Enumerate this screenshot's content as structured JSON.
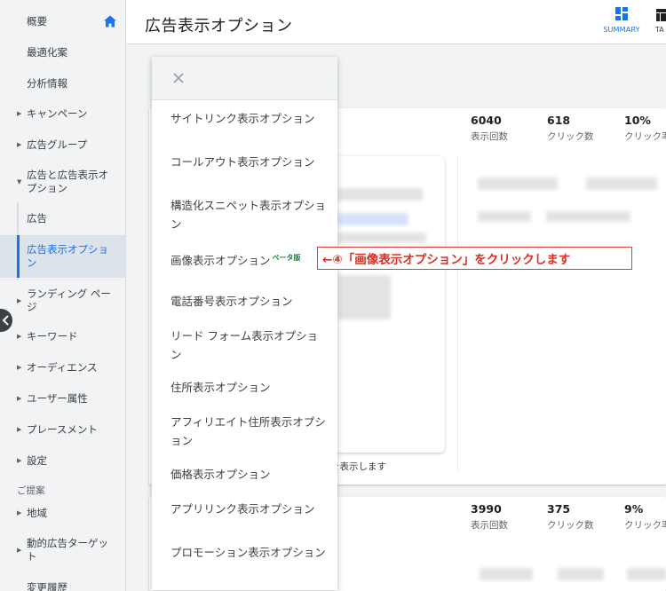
{
  "sidebar": {
    "items": [
      {
        "label": "概要",
        "level": "top"
      },
      {
        "label": "最適化案",
        "level": "top"
      },
      {
        "label": "分析情報",
        "level": "top"
      },
      {
        "label": "キャンペーン",
        "level": "group"
      },
      {
        "label": "広告グループ",
        "level": "group"
      },
      {
        "label": "広告と広告表示オプション",
        "level": "group-open"
      },
      {
        "label": "広告",
        "level": "sub"
      },
      {
        "label": "広告表示オプション",
        "level": "sub-selected"
      },
      {
        "label": "ランディング ページ",
        "level": "group"
      },
      {
        "label": "キーワード",
        "level": "group"
      },
      {
        "label": "オーディエンス",
        "level": "group"
      },
      {
        "label": "ユーザー属性",
        "level": "group"
      },
      {
        "label": "プレースメント",
        "level": "group"
      },
      {
        "label": "設定",
        "level": "group"
      },
      {
        "label": "地域",
        "level": "group"
      },
      {
        "label": "動的広告ターゲット",
        "level": "group"
      },
      {
        "label": "変更履歴",
        "level": "top"
      }
    ],
    "section_title": "ご提案",
    "home_icon": "home-icon",
    "accent_color": "#1a73e8"
  },
  "header": {
    "title": "広告表示オプション",
    "summary_label": "SUMMARY",
    "table_label": "TA"
  },
  "cards": [
    {
      "stats": [
        {
          "value": "6040",
          "caption": "表示回数"
        },
        {
          "value": "618",
          "caption": "クリック数"
        },
        {
          "value": "10%",
          "caption": "クリック率"
        }
      ],
      "footnote": "を表示します"
    },
    {
      "stats": [
        {
          "value": "3990",
          "caption": "表示回数"
        },
        {
          "value": "375",
          "caption": "クリック数"
        },
        {
          "value": "9%",
          "caption": "クリック率"
        }
      ]
    }
  ],
  "menu": {
    "close_icon": "close-icon",
    "items": [
      {
        "label": "サイトリンク表示オプション"
      },
      {
        "label": "コールアウト表示オプション"
      },
      {
        "label": "構造化スニペット表示オプション"
      },
      {
        "label": "画像表示オプション",
        "badge": "ベータ版"
      },
      {
        "label": "電話番号表示オプション"
      },
      {
        "label": "リード フォーム表示オプション"
      },
      {
        "label": "住所表示オプション"
      },
      {
        "label": "アフィリエイト住所表示オプション"
      },
      {
        "label": "価格表示オプション"
      },
      {
        "label": "アプリリンク表示オプション"
      },
      {
        "label": "プロモーション表示オプション"
      }
    ]
  },
  "annotation": {
    "text": "←④「画像表示オプション」をクリックします",
    "color": "#d93025"
  }
}
